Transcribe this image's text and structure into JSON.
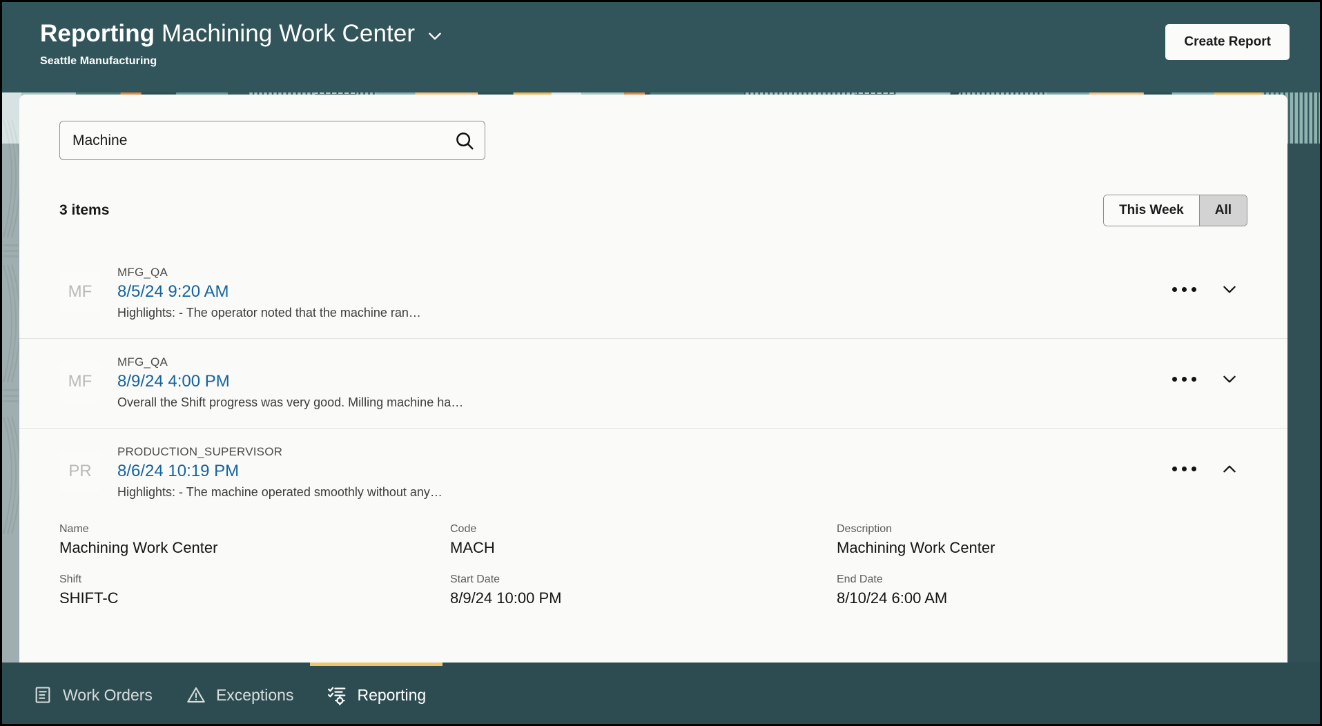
{
  "header": {
    "title_strong": "Reporting",
    "title_rest": "Machining Work Center",
    "title_chevron_icon": "chevron-down-icon",
    "subtitle": "Seattle Manufacturing",
    "create_report_label": "Create Report",
    "background_color": "#32555b"
  },
  "search": {
    "value": "Machine",
    "placeholder": "Search",
    "icon": "search-icon"
  },
  "list_meta": {
    "items_count": "3 items",
    "filters": [
      {
        "label": "This Week",
        "selected": false
      },
      {
        "label": "All",
        "selected": true
      }
    ]
  },
  "list": {
    "rows": [
      {
        "avatar_initials": "MF",
        "user": "MFG_QA",
        "date": "8/5/24 9:20 AM",
        "snippet": "Highlights: - The operator noted that the machine ran…",
        "more_icon": "more-options-icon",
        "toggle_icon": "chevron-down-icon",
        "expanded": false
      },
      {
        "avatar_initials": "MF",
        "user": "MFG_QA",
        "date": "8/9/24 4:00 PM",
        "snippet": "Overall the Shift progress was very good. Milling machine ha…",
        "more_icon": "more-options-icon",
        "toggle_icon": "chevron-down-icon",
        "expanded": false
      },
      {
        "avatar_initials": "PR",
        "user": "PRODUCTION_SUPERVISOR",
        "date": "8/6/24 10:19 PM",
        "snippet": "Highlights: - The machine operated smoothly without any…",
        "more_icon": "more-options-icon",
        "toggle_icon": "chevron-up-icon",
        "expanded": true
      }
    ]
  },
  "details": {
    "fields": [
      {
        "label": "Name",
        "value": "Machining Work Center"
      },
      {
        "label": "Code",
        "value": "MACH"
      },
      {
        "label": "Description",
        "value": "Machining Work Center"
      },
      {
        "label": "Shift",
        "value": "SHIFT-C"
      },
      {
        "label": "Start Date",
        "value": "8/9/24 10:00 PM"
      },
      {
        "label": "End Date",
        "value": "8/10/24 6:00 AM"
      }
    ]
  },
  "bottom_nav": {
    "items": [
      {
        "label": "Work Orders",
        "icon": "document-list-icon",
        "active": false
      },
      {
        "label": "Exceptions",
        "icon": "warning-triangle-icon",
        "active": false
      },
      {
        "label": "Reporting",
        "icon": "checklist-gear-icon",
        "active": true
      }
    ],
    "active_indicator_color": "#f0c46a"
  }
}
